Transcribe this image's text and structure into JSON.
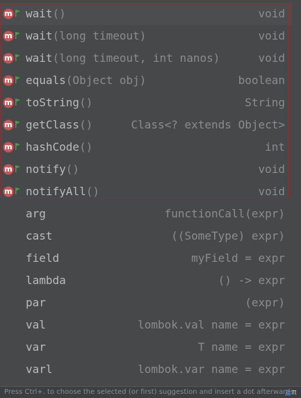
{
  "completion_popup": {
    "method_items": [
      {
        "name": "wait",
        "params": "()",
        "type": "void",
        "icon": "method-icon",
        "visibility": "public"
      },
      {
        "name": "wait",
        "params": "(long timeout)",
        "type": "void",
        "icon": "method-icon",
        "visibility": "public"
      },
      {
        "name": "wait",
        "params": "(long timeout, int nanos)",
        "type": "void",
        "icon": "method-icon",
        "visibility": "public"
      },
      {
        "name": "equals",
        "params": "(Object obj)",
        "type": "boolean",
        "icon": "method-icon",
        "visibility": "public"
      },
      {
        "name": "toString",
        "params": "()",
        "type": "String",
        "icon": "method-icon",
        "visibility": "public"
      },
      {
        "name": "getClass",
        "params": "()",
        "type": "Class<? extends Object>",
        "icon": "method-icon",
        "visibility": "public"
      },
      {
        "name": "hashCode",
        "params": "()",
        "type": "int",
        "icon": "method-icon",
        "visibility": "public"
      },
      {
        "name": "notify",
        "params": "()",
        "type": "void",
        "icon": "method-icon",
        "visibility": "public"
      },
      {
        "name": "notifyAll",
        "params": "()",
        "type": "void",
        "icon": "method-icon",
        "visibility": "public"
      }
    ],
    "template_items": [
      {
        "name": "arg",
        "type": "functionCall(expr)"
      },
      {
        "name": "cast",
        "type": "((SomeType) expr)"
      },
      {
        "name": "field",
        "type": "myField = expr"
      },
      {
        "name": "lambda",
        "type": "() -> expr"
      },
      {
        "name": "par",
        "type": "(expr)"
      },
      {
        "name": "val",
        "type": "lombok.val name = expr"
      },
      {
        "name": "var",
        "type": "T name = expr"
      },
      {
        "name": "varl",
        "type": "lombok.var name = expr"
      }
    ],
    "selected_index": 0,
    "footer": {
      "hint": "Press Ctrl+. to choose the selected (or first) suggestion and insert a dot afterwards",
      "link": "≥",
      "pi": "π"
    }
  },
  "colors": {
    "background": "#46484a",
    "selection": "#4b4d4f",
    "text": "#bbbbbb",
    "secondary_text": "#8c8c8c",
    "highlight_frame": "#b32020",
    "method_icon": "#c05a5a",
    "public_icon": "#4a9a4a",
    "link": "#589df6"
  }
}
